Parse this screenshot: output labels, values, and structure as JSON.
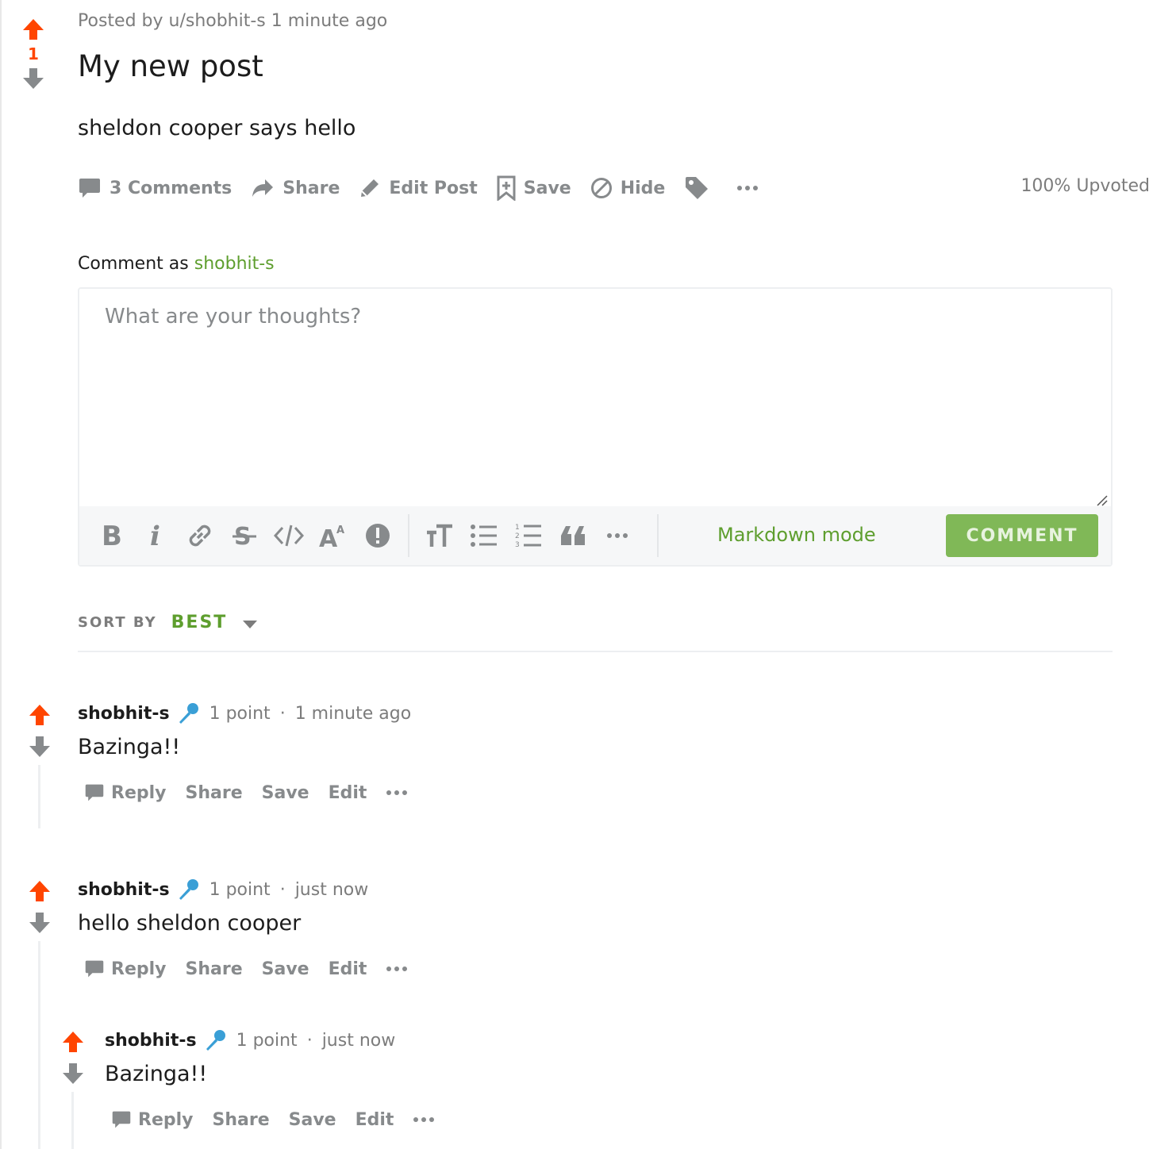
{
  "post": {
    "meta": "Posted by u/shobhit-s 1 minute ago",
    "title": "My new post",
    "body": "sheldon cooper says hello",
    "score": "1",
    "actions": {
      "comments": "3 Comments",
      "share": "Share",
      "edit": "Edit Post",
      "save": "Save",
      "hide": "Hide"
    },
    "upvoted": "100% Upvoted"
  },
  "composer": {
    "label": "Comment as",
    "username": "shobhit-s",
    "placeholder": "What are your thoughts?",
    "markdown_mode": "Markdown mode",
    "submit": "COMMENT",
    "toolbar_icons": [
      "bold-icon",
      "italic-icon",
      "link-icon",
      "strikethrough-icon",
      "code-icon",
      "superscript-icon",
      "spoiler-icon",
      "heading-icon",
      "bulleted-list-icon",
      "numbered-list-icon",
      "quote-icon",
      "more-icon"
    ]
  },
  "sort": {
    "label": "SORT BY",
    "value": "BEST"
  },
  "comments": [
    {
      "user": "shobhit-s",
      "points": "1 point",
      "time": "1 minute ago",
      "text": "Bazinga!!"
    },
    {
      "user": "shobhit-s",
      "points": "1 point",
      "time": "just now",
      "text": "hello sheldon cooper"
    },
    {
      "user": "shobhit-s",
      "points": "1 point",
      "time": "just now",
      "text": "Bazinga!!"
    }
  ],
  "comment_actions": {
    "reply": "Reply",
    "share": "Share",
    "save": "Save",
    "edit": "Edit"
  },
  "colors": {
    "upvote": "#ff4500",
    "accent_green": "#5e9e2e",
    "button_green": "#80b857",
    "muted": "#878a8c",
    "flair_blue": "#3a9fd6"
  }
}
